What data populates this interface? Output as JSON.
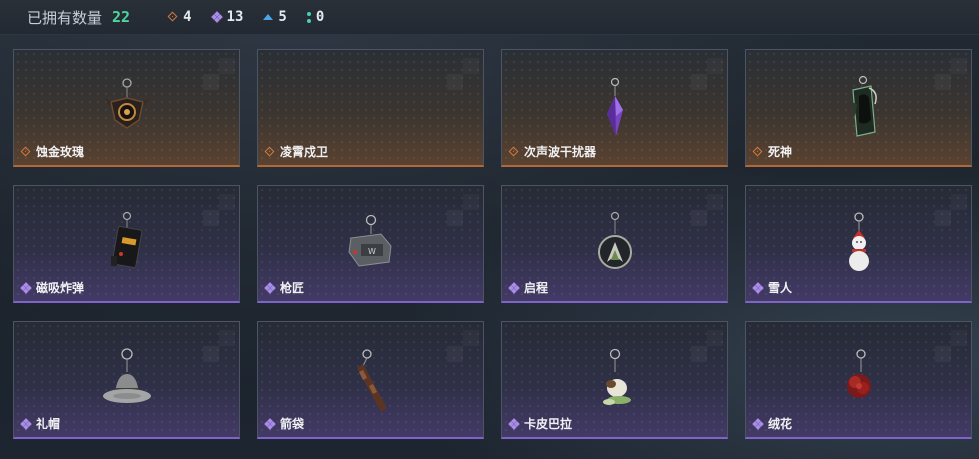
{
  "header": {
    "owned_label": "已拥有数量",
    "owned_count": "22",
    "stats": [
      {
        "icon": "orange-diamond-icon",
        "value": "4",
        "color": "#d5783e"
      },
      {
        "icon": "purple-diamond-icon",
        "value": "13",
        "color": "#a98ce8"
      },
      {
        "icon": "blue-chevron-icon",
        "value": "5",
        "color": "#4aa6e8"
      },
      {
        "icon": "teal-dots-icon",
        "value": "0",
        "color": "#45d1b8"
      }
    ]
  },
  "items": [
    {
      "name": "蚀金玫瑰",
      "rarity": "orange",
      "icon": "rose-emblem-charm-icon"
    },
    {
      "name": "凌霄戍卫",
      "rarity": "orange",
      "icon": "empty-charm-icon"
    },
    {
      "name": "次声波干扰器",
      "rarity": "orange",
      "icon": "purple-crystal-charm-icon"
    },
    {
      "name": "死神",
      "rarity": "orange",
      "icon": "reaper-card-charm-icon"
    },
    {
      "name": "磁吸炸弹",
      "rarity": "purple",
      "icon": "bomb-charm-icon"
    },
    {
      "name": "枪匠",
      "rarity": "purple",
      "icon": "gunsmith-plate-charm-icon"
    },
    {
      "name": "启程",
      "rarity": "purple",
      "icon": "ring-emblem-charm-icon"
    },
    {
      "name": "雪人",
      "rarity": "purple",
      "icon": "snowman-charm-icon"
    },
    {
      "name": "礼帽",
      "rarity": "purple",
      "icon": "hat-charm-icon"
    },
    {
      "name": "箭袋",
      "rarity": "purple",
      "icon": "quiver-charm-icon"
    },
    {
      "name": "卡皮巴拉",
      "rarity": "purple",
      "icon": "capybara-charm-icon"
    },
    {
      "name": "绒花",
      "rarity": "purple",
      "icon": "red-flower-charm-icon"
    }
  ]
}
